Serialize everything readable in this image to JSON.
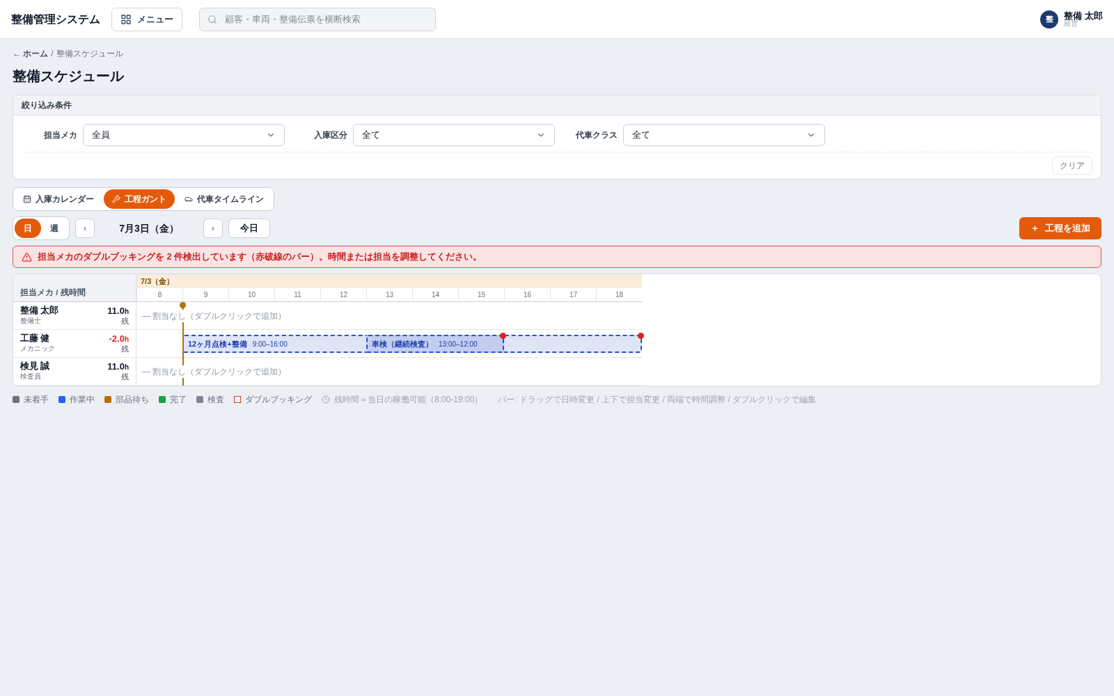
{
  "app_title": "整備管理システム",
  "menu_button": "メニュー",
  "search": {
    "placeholder": "顧客・車両・整備伝票を横断検索"
  },
  "user": {
    "avatar": "整",
    "name": "整備 太郎",
    "role": "経営"
  },
  "breadcrumb": {
    "back": "← ホーム",
    "separator": "/",
    "current": "整備スケジュール"
  },
  "page_title": "整備スケジュール",
  "filters": {
    "title": "絞り込み条件",
    "fields": [
      {
        "label": "担当メカ",
        "value": "全員"
      },
      {
        "label": "入庫区分",
        "value": "全て"
      },
      {
        "label": "代車クラス",
        "value": "全て"
      }
    ],
    "clear_button": "クリア"
  },
  "view_tabs": [
    {
      "label": "入庫カレンダー",
      "selected": false
    },
    {
      "label": "工程ガント",
      "selected": true
    },
    {
      "label": "代車タイムライン",
      "selected": false
    }
  ],
  "range_toggle": [
    {
      "label": "日",
      "selected": true
    },
    {
      "label": "週",
      "selected": false
    }
  ],
  "prev": "‹",
  "date": "7月3日（金）",
  "next": "›",
  "today_button": "今日",
  "add_button": {
    "icon": "＋",
    "label": "工程を追加"
  },
  "alert": "担当メカのダブルブッキングを **2** 件検出しています（赤破線のバー）。時間または担当を調整してください。",
  "gantt": {
    "corner": "担当メカ / 残時間",
    "date": "7/3（金）",
    "hours": [
      "8",
      "9",
      "10",
      "11",
      "12",
      "13",
      "14",
      "15",
      "16",
      "17",
      "18"
    ],
    "rows": [
      {
        "name": "整備 太郎",
        "role": "整備士",
        "remaining": "11.0",
        "unit": "h",
        "remaining_label": "残",
        "negative": false,
        "empty_text": "— 割当なし（ダブルクリックで追加）",
        "bars": []
      },
      {
        "name": "工藤 健",
        "role": "メカニック",
        "remaining": "-2.0",
        "unit": "h",
        "remaining_label": "残",
        "negative": true,
        "bars": [
          {
            "title": "12ヶ月点検+整備",
            "time": "9:00–16:00",
            "double_booking": true
          },
          {
            "title": "車検（継続検査）",
            "time": "13:00–12:00",
            "double_booking": true
          }
        ]
      },
      {
        "name": "検見 誠",
        "role": "検査員",
        "remaining": "11.0",
        "unit": "h",
        "remaining_label": "残",
        "negative": false,
        "empty_text": "— 割当なし（ダブルクリックで追加）",
        "bars": []
      }
    ]
  },
  "legend": [
    {
      "kind": "swatch",
      "label": "未着手",
      "color": "#6b7280"
    },
    {
      "kind": "swatch",
      "label": "作業中",
      "color": "#2563eb"
    },
    {
      "kind": "swatch",
      "label": "部品待ち",
      "color": "#b86e0b"
    },
    {
      "kind": "swatch",
      "label": "完了",
      "color": "#16a34a"
    },
    {
      "kind": "swatch",
      "label": "検査",
      "color": "#7b8594"
    },
    {
      "kind": "dashed",
      "label": "ダブルブッキング"
    },
    {
      "kind": "clock",
      "label": "残時間＝当日の稼働可能（8:00-19:00）"
    },
    {
      "kind": "note",
      "label": "バー: ドラッグで日時変更 / 上下で担当変更 / 両端で時間調整 / ダブルクリックで編集"
    }
  ]
}
